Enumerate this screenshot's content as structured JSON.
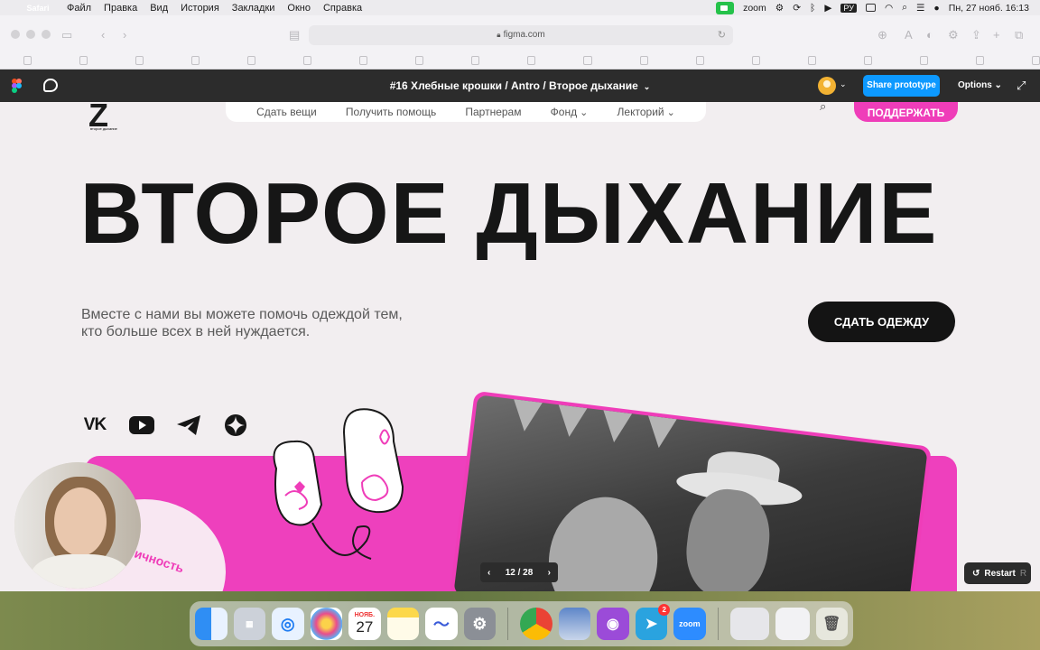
{
  "menubar": {
    "app": "Safari",
    "items": [
      "Файл",
      "Правка",
      "Вид",
      "История",
      "Закладки",
      "Окно",
      "Справка"
    ],
    "zoom_label": "zoom",
    "keyboard_layout": "РУ",
    "datetime": "Пн, 27 нояб.  16:13"
  },
  "browser": {
    "url": "figma.com"
  },
  "figma": {
    "title": "#16 Хлебные крошки / Antro / Второе дыхание",
    "share_label": "Share prototype",
    "options_label": "Options",
    "page_indicator": "12 / 28",
    "restart_label": "Restart",
    "restart_key": "R",
    "accent_color": "#0d99ff"
  },
  "site": {
    "logo_text": "второе дыхание",
    "nav": [
      "Сдать вещи",
      "Получить помощь",
      "Партнерам",
      "Фонд",
      "Лекторий"
    ],
    "donate_label": "ПОДДЕРЖАТЬ",
    "hero_title": "ВТОРОЕ ДЫХАНИЕ",
    "lead_text": "Вместе с нами вы можете помочь одеждой тем, кто больше всех в ней нуждается.",
    "cta_label": "СДАТЬ ОДЕЖДУ",
    "socials": [
      "vk-icon",
      "youtube-icon",
      "telegram-icon",
      "dzen-icon"
    ],
    "vk_text": "VK",
    "blob_text": "ичность",
    "brand_color": "#ef3db9"
  },
  "dock": {
    "calendar_month": "НОЯБ.",
    "calendar_day": "27",
    "telegram_badge": "2",
    "zoom_label": "zoom"
  }
}
